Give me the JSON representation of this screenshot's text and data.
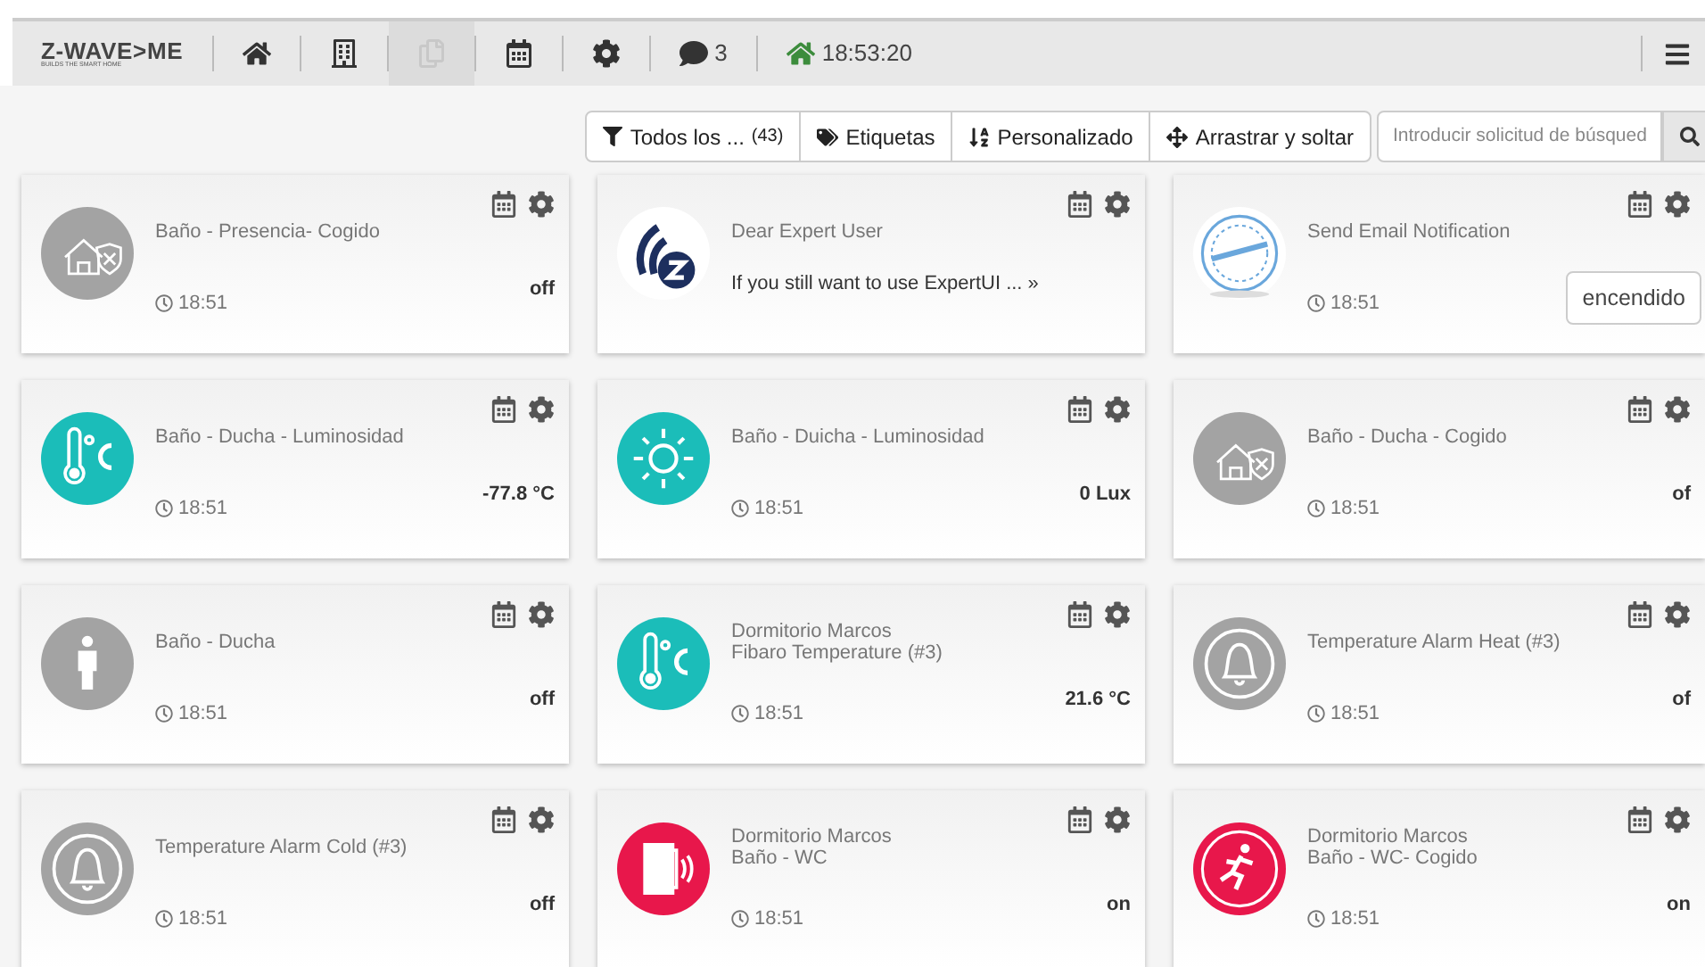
{
  "navbar": {
    "logo": "Z-WAVE>ME",
    "tagline": "BUILDS THE SMART HOME",
    "items": [
      {
        "kind": "home",
        "selected": false
      },
      {
        "kind": "building",
        "selected": false
      },
      {
        "kind": "copy",
        "selected": true
      },
      {
        "kind": "calendar",
        "selected": false
      },
      {
        "kind": "settings",
        "selected": false
      },
      {
        "kind": "messages",
        "label": "3",
        "selected": false
      },
      {
        "kind": "clock",
        "label": "18:53:20",
        "selected": false
      }
    ]
  },
  "toolbar": {
    "filter": {
      "label": "Todos los ...",
      "count": "(43)"
    },
    "tags": "Etiquetas",
    "sort": "Personalizado",
    "drag": "Arrastrar y soltar",
    "search": {
      "placeholder": "Introducir solicitud de búsqued"
    }
  },
  "cards": [
    {
      "kind": "security",
      "color": "#a3a3a3",
      "name": "Baño - Presencia- Cogido",
      "time": "18:51",
      "value": "off"
    },
    {
      "kind": "zwave",
      "color": "#ffffff",
      "name": "Dear Expert User",
      "message": "If you still want to use ExpertUI ... »"
    },
    {
      "kind": "email",
      "color": "#ffffff",
      "name": "Send Email Notification",
      "time": "18:51",
      "button": "encendido"
    },
    {
      "kind": "thermometer",
      "color": "#1bbdb9",
      "name": "Baño - Ducha - Luminosidad",
      "time": "18:51",
      "value": "-77.8 °C"
    },
    {
      "kind": "sun",
      "color": "#1bbdb9",
      "name": "Baño - Duicha - Luminosidad",
      "time": "18:51",
      "value": "0 Lux"
    },
    {
      "kind": "security",
      "color": "#a3a3a3",
      "name": "Baño - Ducha - Cogido",
      "time": "18:51",
      "value": "of"
    },
    {
      "kind": "person",
      "color": "#a3a3a3",
      "name": "Baño - Ducha",
      "time": "18:51",
      "value": "off"
    },
    {
      "kind": "thermometer",
      "color": "#1bbdb9",
      "location": "Dormitorio Marcos",
      "name": "Fibaro Temperature (#3)",
      "time": "18:51",
      "value": "21.6 °C"
    },
    {
      "kind": "bell",
      "color": "#a3a3a3",
      "name": "Temperature Alarm Heat (#3)",
      "time": "18:51",
      "value": "of"
    },
    {
      "kind": "bell",
      "color": "#a3a3a3",
      "name": "Temperature Alarm Cold (#3)",
      "time": "18:51",
      "value": "off"
    },
    {
      "kind": "door",
      "color": "#e8174b",
      "location": "Dormitorio Marcos",
      "name": "Baño - WC",
      "time": "18:51",
      "value": "on"
    },
    {
      "kind": "runner",
      "color": "#e8174b",
      "location": "Dormitorio Marcos",
      "name": "Baño - WC- Cogido",
      "time": "18:51",
      "value": "on"
    }
  ]
}
